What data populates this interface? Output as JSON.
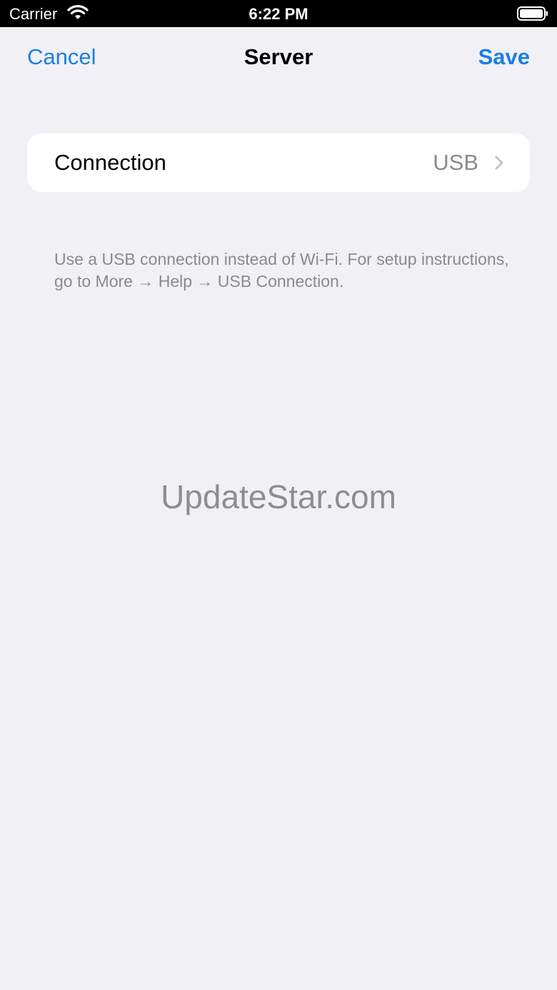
{
  "status_bar": {
    "carrier": "Carrier",
    "time": "6:22 PM",
    "icons": [
      "wifi-icon",
      "battery-icon"
    ]
  },
  "nav": {
    "cancel_label": "Cancel",
    "title": "Server",
    "save_label": "Save"
  },
  "settings": {
    "connection_row": {
      "label": "Connection",
      "value": "USB",
      "icon": "chevron-right-icon"
    },
    "footer_note": "Use a USB connection instead of Wi-Fi. For setup instructions, go to More → Help → USB Connection."
  },
  "watermark": "UpdateStar.com",
  "colors": {
    "accent": "#1a7fe3",
    "background": "#f0f0f5",
    "card": "#ffffff",
    "secondary_text": "#8a8a8e"
  }
}
